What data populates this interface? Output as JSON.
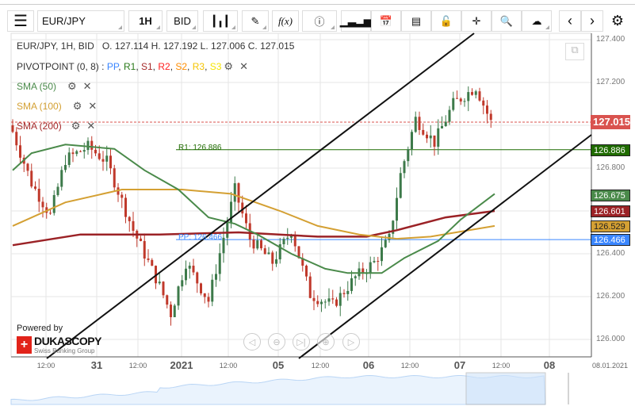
{
  "toolbar": {
    "symbol": "EUR/JPY",
    "timeframe": "1H",
    "side": "BID",
    "fx": "f(x)"
  },
  "legend": {
    "ohlc": "EUR/JPY, 1H, BID   O. 127.114 H. 127.192 L. 127.006 C. 127.015",
    "pivot": "PIVOTPOINT (0, 8)",
    "pivot_sep": " : ",
    "pivot_items": [
      {
        "t": "PP",
        "c": "#3a86ff"
      },
      {
        "t": "R1",
        "c": "#2a7a1a"
      },
      {
        "t": "S1",
        "c": "#a52a2a"
      },
      {
        "t": "R2",
        "c": "#ff2020"
      },
      {
        "t": "S2",
        "c": "#ff8c00"
      },
      {
        "t": "R3",
        "c": "#f5c400"
      },
      {
        "t": "S3",
        "c": "#f5e400"
      }
    ],
    "sma50": "SMA (50)",
    "sma100": "SMA (100)",
    "sma200": "SMA (200)"
  },
  "lines": {
    "r1_label": "R1: 126.886",
    "pp_label": "PP: 126.466"
  },
  "price_labels": [
    {
      "v": "127.015",
      "p": 127.015,
      "c": "#d9534f"
    },
    {
      "v": "126.886",
      "p": 126.886,
      "c": "#1f6b00"
    },
    {
      "v": "126.675",
      "p": 126.675,
      "c": "#4a8a4a"
    },
    {
      "v": "126.601",
      "p": 126.601,
      "c": "#9b2226"
    },
    {
      "v": "126.529",
      "p": 126.529,
      "c": "#d4a033"
    },
    {
      "v": "126.466",
      "p": 126.466,
      "c": "#3a86ff"
    }
  ],
  "y_ticks": [
    "127.400",
    "127.200",
    "126.800",
    "126.400",
    "126.200",
    "126.000"
  ],
  "x_labels": [
    {
      "t": "12:00",
      "b": false
    },
    {
      "t": "31",
      "b": true
    },
    {
      "t": "12:00",
      "b": false
    },
    {
      "t": "2021",
      "b": true
    },
    {
      "t": "12:00",
      "b": false
    },
    {
      "t": "05",
      "b": true
    },
    {
      "t": "12:00",
      "b": false
    },
    {
      "t": "06",
      "b": true
    },
    {
      "t": "12:00",
      "b": false
    },
    {
      "t": "07",
      "b": true
    },
    {
      "t": "12:00",
      "b": false
    },
    {
      "t": "08",
      "b": true
    }
  ],
  "date_label": "08.01.2021",
  "branding": {
    "powered": "Powered by",
    "name": "DUKASCOPY",
    "sub": "Swiss Banking Group"
  },
  "colors": {
    "up": "#3d7a4a",
    "down": "#c0392b",
    "sma50": "#4a8a4a",
    "sma100": "#d4a033",
    "sma200": "#9b2226",
    "r1": "#1f6b00",
    "pp": "#3a86ff"
  },
  "chart_data": {
    "type": "candlestick",
    "symbol": "EUR/JPY",
    "interval": "1H",
    "ylim": [
      126.0,
      127.4
    ],
    "close_path": [
      [
        0,
        126.97
      ],
      [
        5,
        126.73
      ],
      [
        10,
        126.58
      ],
      [
        14,
        126.84
      ],
      [
        20,
        126.9
      ],
      [
        25,
        126.83
      ],
      [
        32,
        126.51
      ],
      [
        39,
        126.25
      ],
      [
        42,
        126.12
      ],
      [
        46,
        126.36
      ],
      [
        52,
        126.18
      ],
      [
        59,
        126.7
      ],
      [
        63,
        126.47
      ],
      [
        69,
        126.36
      ],
      [
        74,
        126.51
      ],
      [
        79,
        126.21
      ],
      [
        85,
        126.16
      ],
      [
        91,
        126.29
      ],
      [
        96,
        126.36
      ],
      [
        100,
        126.47
      ],
      [
        103,
        126.77
      ],
      [
        107,
        127.03
      ],
      [
        112,
        126.92
      ],
      [
        117,
        127.1
      ],
      [
        123,
        127.18
      ],
      [
        127,
        127.015
      ]
    ],
    "sma50": [
      [
        0,
        126.79
      ],
      [
        5,
        126.87
      ],
      [
        14,
        126.91
      ],
      [
        27,
        126.89
      ],
      [
        35,
        126.79
      ],
      [
        44,
        126.7
      ],
      [
        52,
        126.57
      ],
      [
        59,
        126.54
      ],
      [
        65,
        126.49
      ],
      [
        74,
        126.4
      ],
      [
        83,
        126.33
      ],
      [
        89,
        126.31
      ],
      [
        98,
        126.31
      ],
      [
        104,
        126.38
      ],
      [
        113,
        126.46
      ],
      [
        119,
        126.56
      ],
      [
        128,
        126.68
      ]
    ],
    "sma100": [
      [
        0,
        126.53
      ],
      [
        14,
        126.64
      ],
      [
        29,
        126.7
      ],
      [
        45,
        126.7
      ],
      [
        58,
        126.68
      ],
      [
        71,
        126.6
      ],
      [
        81,
        126.53
      ],
      [
        92,
        126.49
      ],
      [
        102,
        126.47
      ],
      [
        111,
        126.48
      ],
      [
        128,
        126.53
      ]
    ],
    "sma200": [
      [
        0,
        126.44
      ],
      [
        18,
        126.49
      ],
      [
        39,
        126.49
      ],
      [
        60,
        126.5
      ],
      [
        81,
        126.48
      ],
      [
        94,
        126.48
      ],
      [
        102,
        126.51
      ],
      [
        115,
        126.57
      ],
      [
        128,
        126.6
      ]
    ]
  }
}
